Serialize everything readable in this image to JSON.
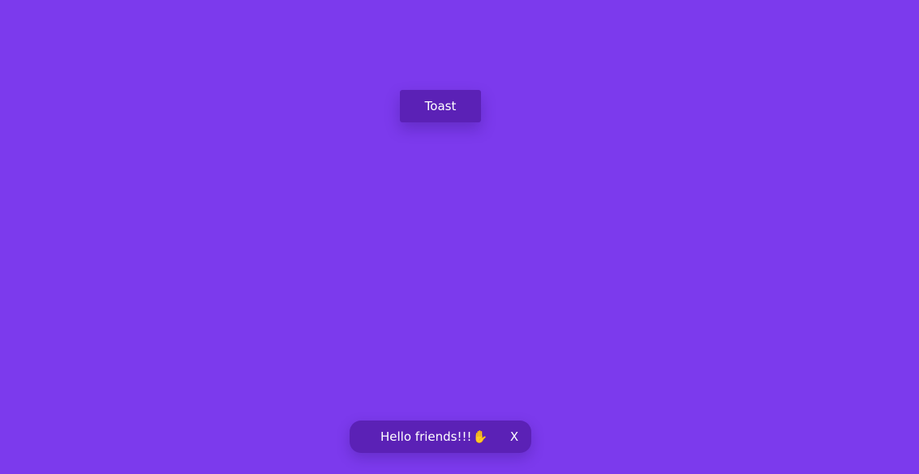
{
  "colors": {
    "background": "#7c3aed",
    "button": "#5b21b6",
    "toast": "#5b21b6",
    "text": "#ffffff",
    "emoji": "#f5b82e"
  },
  "trigger": {
    "label": "Toast"
  },
  "toast": {
    "message": "Hello friends!!!",
    "emoji": "✋",
    "emoji_icon": "raised-hand-icon",
    "close_label": "X"
  }
}
